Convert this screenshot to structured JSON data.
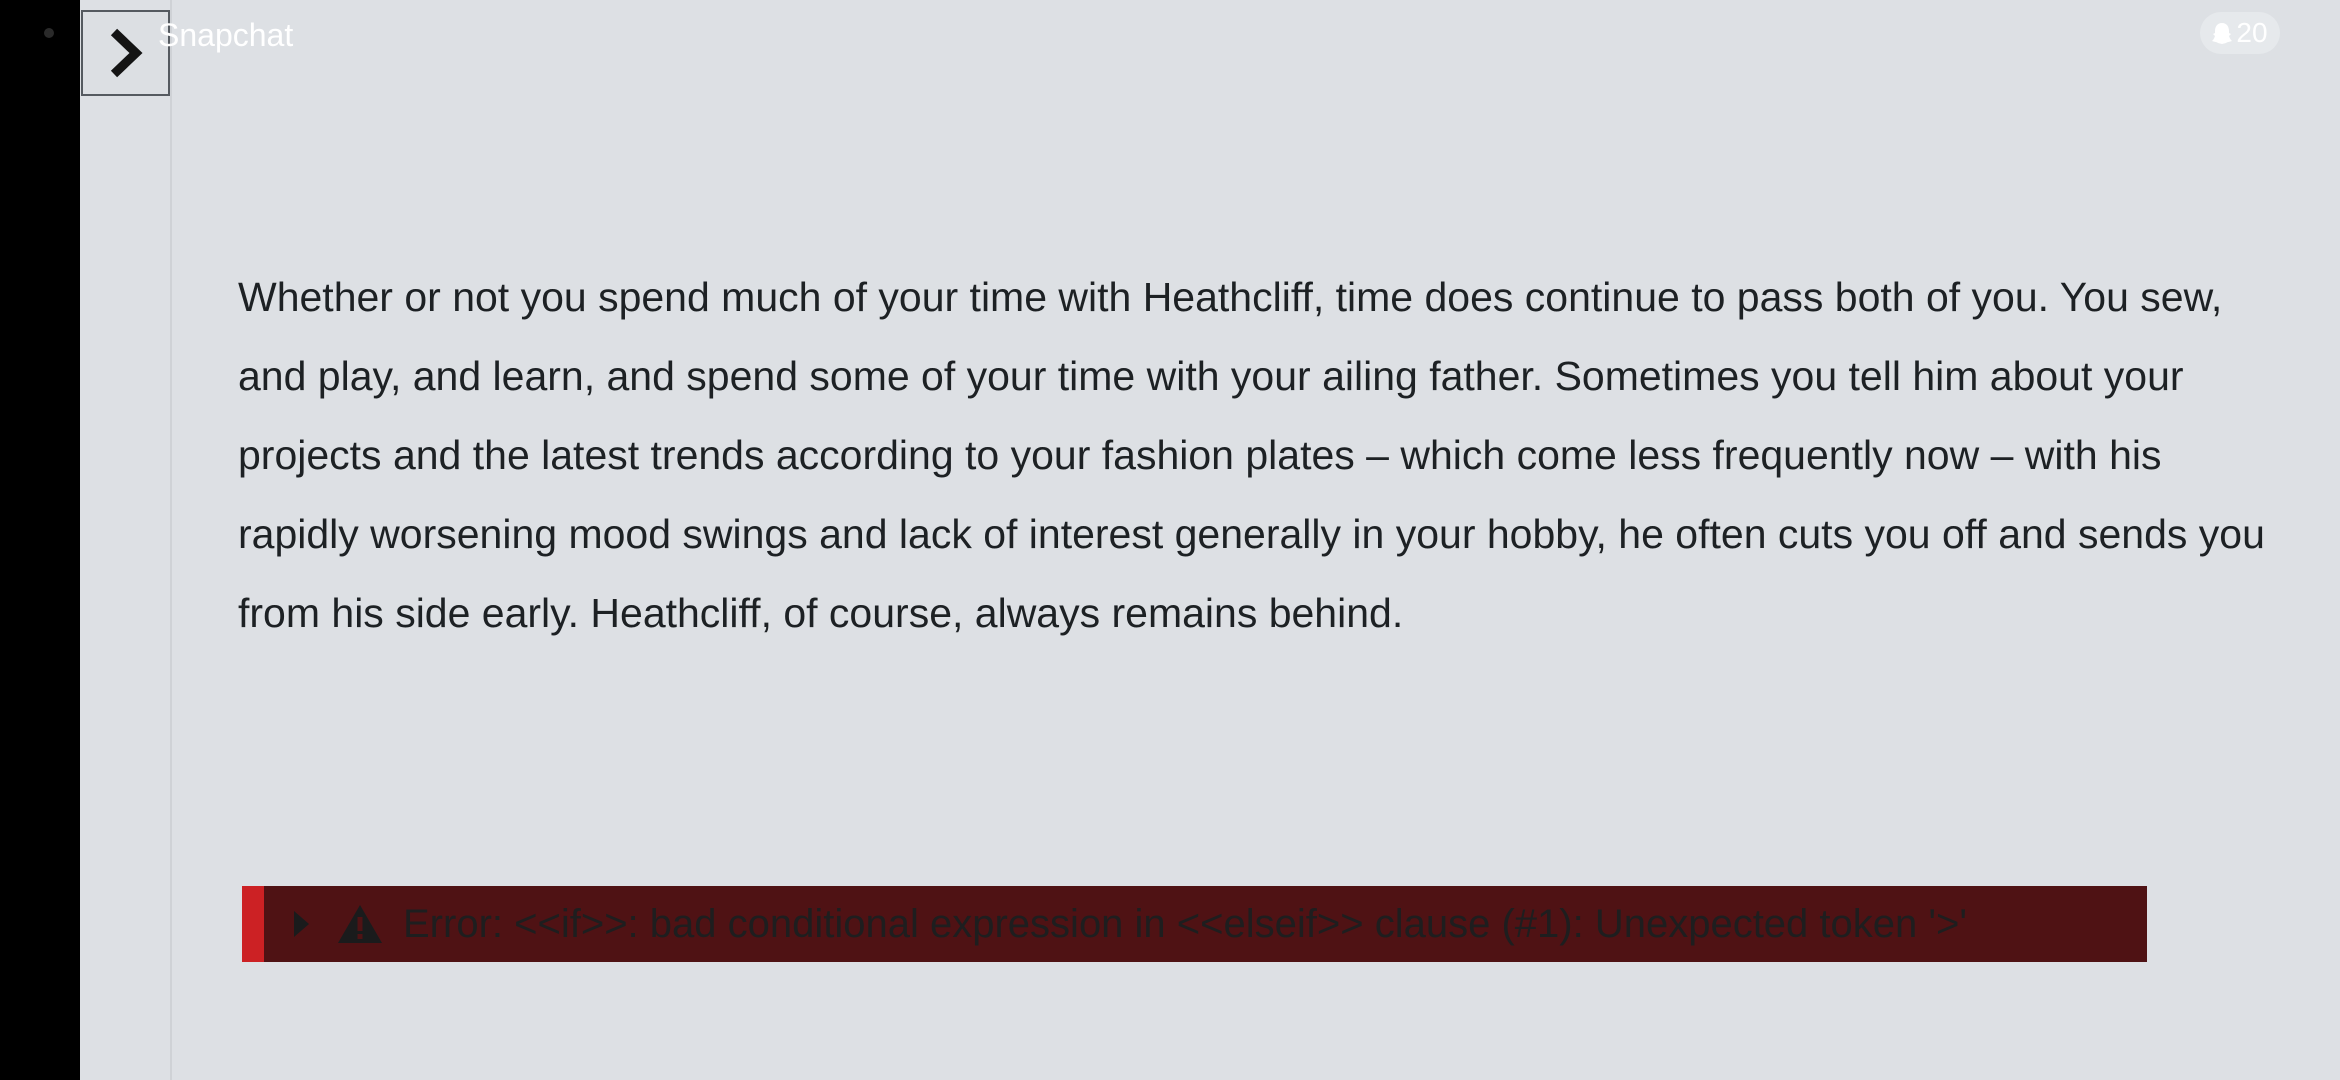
{
  "status_bar": {
    "app_name": "Snapchat",
    "badge_count": "20",
    "badge_icon": "snapchat-ghost-icon"
  },
  "sidebar": {
    "toggle_icon": "chevron-right-icon"
  },
  "passage": {
    "text": "Whether or not you spend much of your time with Heathcliff, time does continue to pass both of you. You sew, and play, and learn, and spend some of your time with your ailing father. Sometimes you tell him about your projects and the latest trends according to your fashion plates – which come less frequently now – with his rapidly worsening mood swings and lack of interest generally in your hobby, he often cuts you off and sends you from his side early. Heathcliff, of course, always remains behind."
  },
  "error": {
    "message": "Error: <<if>>: bad conditional expression in <<elseif>> clause (#1): Unexpected token '>'",
    "icons": [
      "caret-right-icon",
      "warning-icon"
    ],
    "background_color": "#4f1214",
    "accent_color": "#cc2124"
  },
  "colors": {
    "page_background": "#dde0e4",
    "text": "#1d2124"
  }
}
